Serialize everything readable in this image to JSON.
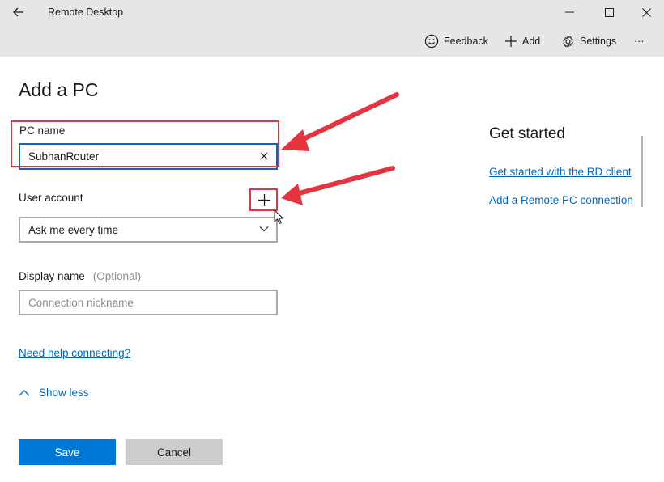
{
  "window": {
    "title": "Remote Desktop"
  },
  "commands": {
    "feedback": "Feedback",
    "add": "Add",
    "settings": "Settings",
    "more": "···"
  },
  "form": {
    "title": "Add a PC",
    "pc_name_label": "PC name",
    "pc_name_value": "SubhanRouter",
    "user_account_label": "User account",
    "user_account_value": "Ask me every time",
    "display_name_label": "Display name",
    "display_name_optional": "(Optional)",
    "display_name_placeholder": "Connection nickname",
    "help_link": "Need help connecting?",
    "show_less": "Show less",
    "save": "Save",
    "cancel": "Cancel"
  },
  "side": {
    "title": "Get started",
    "link1": "Get started with the RD client",
    "link2": "Add a Remote PC connection"
  },
  "colors": {
    "accent": "#0078d7",
    "link": "#0067b8",
    "annotation": "#e5343f",
    "chrome": "#e6e6e6"
  },
  "icons": {
    "back": "back-arrow-icon",
    "minimize": "minimize-icon",
    "maximize": "maximize-icon",
    "close": "close-icon",
    "feedback": "smiley-icon",
    "add": "plus-icon",
    "settings": "gear-icon",
    "clear": "clear-x-icon",
    "dropdown": "chevron-down-icon",
    "show_less": "chevron-up-icon"
  }
}
